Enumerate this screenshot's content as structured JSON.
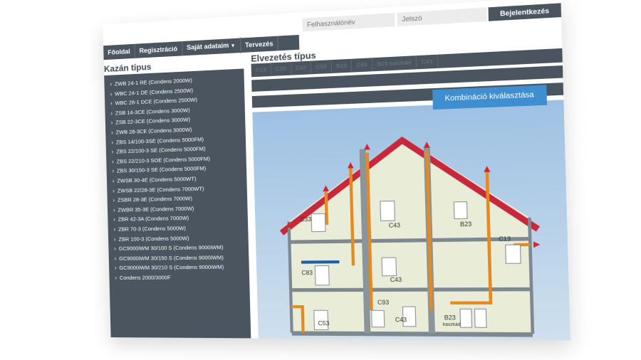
{
  "login": {
    "username_placeholder": "Felhasználónév",
    "password_placeholder": "Jelszó",
    "login_button": "Bejelentkezés"
  },
  "nav": {
    "items": [
      {
        "label": "Főoldal"
      },
      {
        "label": "Regisztráció"
      },
      {
        "label": "Saját adataim"
      },
      {
        "label": "Tervezés"
      }
    ]
  },
  "sidebar": {
    "title": "Kazán típus",
    "items": [
      "ZWB 24-1 RE (Condens 2000W)",
      "WBC 24-1 DE (Condens 2500W)",
      "WBC 28-1 DCE (Condens 2500W)",
      "ZSB 14-3CE (Condens 3000W)",
      "ZSB 22-3CE (Condens 3000W)",
      "ZWB 28-3CE (Condens 3000W)",
      "ZBS 14/100-3SE (Condens 5000FM)",
      "ZBS 22/100-3 SE (Condens 5000FM)",
      "ZBS 22/210-3 SOE (Condens 5000FM)",
      "ZBS 30/150-3 SE (Condens 5000FM)",
      "ZWSB 30-4E (Condens 5000WT)",
      "ZWSB 22/28-3E (Condens 7000WT)",
      "ZSBR 28-3E (Condens 7000W)",
      "ZWBR 35-3E (Condens 7000W)",
      "ZBR 42-3A (Condens 7000W)",
      "ZBR 70-3 (Condens 5000W)",
      "ZBR 100-3 (Condens 5000W)",
      "GC9000iWM 30/100 S (Condens 9000iWM)",
      "GC9000iWM 30/150 S (Condens 9000iWM)",
      "GC9000iWM 30/210 S (Condens 9000iWM)",
      "Condens 2000/3000F"
    ]
  },
  "flue": {
    "title": "Elvezetés típus",
    "tabs": [
      "C13",
      "C33",
      "C43",
      "C53",
      "B23",
      "C83",
      "B23 kaszkád",
      "C43"
    ]
  },
  "combo_button": "Kombináció kiválasztása",
  "diagram_labels": {
    "c33": "C33",
    "c43_top": "C43",
    "b23_top": "B23",
    "c13": "C13",
    "c83": "C83",
    "c43_mid": "C43",
    "c93": "C93",
    "c53": "C53",
    "c43_low": "C43",
    "b23_low": "B23",
    "b23_low_sub": "kaszkád"
  },
  "colors": {
    "nav_bg": "#4a5560",
    "accent_blue": "#3e8ed0",
    "roof_red": "#c8283c",
    "pipe_orange": "#e6891f",
    "wall": "#e9edd8",
    "sky": "#b4cfe7"
  }
}
